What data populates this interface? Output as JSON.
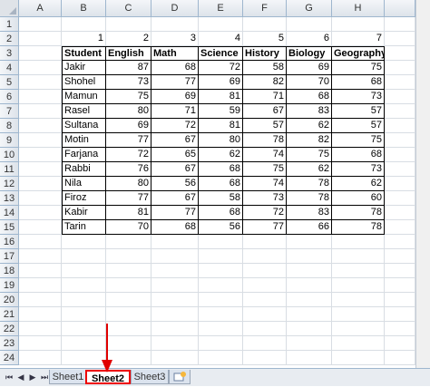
{
  "columns": [
    "A",
    "B",
    "C",
    "D",
    "E",
    "F",
    "G",
    "H"
  ],
  "rows": [
    "1",
    "2",
    "3",
    "4",
    "5",
    "6",
    "7",
    "8",
    "9",
    "10",
    "11",
    "12",
    "13",
    "14",
    "15",
    "16",
    "17",
    "18",
    "19",
    "20",
    "21",
    "22",
    "23",
    "24"
  ],
  "numbers_row": [
    "1",
    "2",
    "3",
    "4",
    "5",
    "6",
    "7"
  ],
  "headers": [
    "Student",
    "English",
    "Math",
    "Science",
    "History",
    "Biology",
    "Geography"
  ],
  "table": [
    [
      "Jakir",
      "87",
      "68",
      "72",
      "58",
      "69",
      "75"
    ],
    [
      "Shohel",
      "73",
      "77",
      "69",
      "82",
      "70",
      "68"
    ],
    [
      "Mamun",
      "75",
      "69",
      "81",
      "71",
      "68",
      "73"
    ],
    [
      "Rasel",
      "80",
      "71",
      "59",
      "67",
      "83",
      "57"
    ],
    [
      "Sultana",
      "69",
      "72",
      "81",
      "57",
      "62",
      "57"
    ],
    [
      "Motin",
      "77",
      "67",
      "80",
      "78",
      "82",
      "75"
    ],
    [
      "Farjana",
      "72",
      "65",
      "62",
      "74",
      "75",
      "68"
    ],
    [
      "Rabbi",
      "76",
      "67",
      "68",
      "75",
      "62",
      "73"
    ],
    [
      "Nila",
      "80",
      "56",
      "68",
      "74",
      "78",
      "62"
    ],
    [
      "Firoz",
      "77",
      "67",
      "58",
      "73",
      "78",
      "60"
    ],
    [
      "Kabir",
      "81",
      "77",
      "68",
      "72",
      "83",
      "78"
    ],
    [
      "Tarin",
      "70",
      "68",
      "56",
      "77",
      "66",
      "78"
    ]
  ],
  "sheet_tabs": [
    "Sheet1",
    "Sheet2",
    "Sheet3"
  ],
  "active_tab": "Sheet2",
  "nav_buttons": [
    "⏮",
    "◀",
    "▶",
    "⏭"
  ],
  "colors": {
    "highlight": "#e00000",
    "header_bg": "#dde3ea",
    "grid_line": "#d8dde3"
  }
}
